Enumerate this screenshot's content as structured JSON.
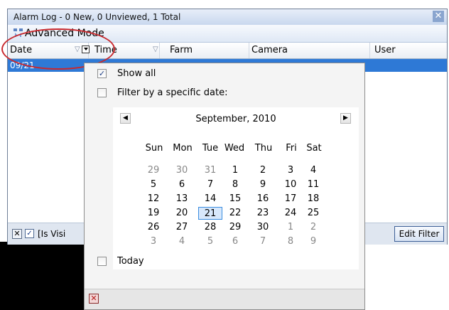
{
  "window": {
    "title": "Alarm Log - 0 New, 0 Unviewed, 1 Total",
    "close_glyph": "✕"
  },
  "toolbar": {
    "mode_label": "Advanced Mode",
    "mode_icon": "advanced-mode-icon"
  },
  "columns": [
    {
      "label": "Date"
    },
    {
      "label": "Time"
    },
    {
      "label": "Farm"
    },
    {
      "label": "Camera"
    },
    {
      "label": "User"
    }
  ],
  "selected_row": {
    "date": "09/21"
  },
  "filter_bar": {
    "clear_glyph": "✕",
    "visible_checked_glyph": "✓",
    "label": "[Is Visi",
    "edit_filter_label": "Edit Filter"
  },
  "popup": {
    "show_all": {
      "label": "Show all",
      "checked": true,
      "check_glyph": "✓"
    },
    "filter_date": {
      "label": "Filter by a specific date:",
      "checked": false
    },
    "today": {
      "label": "Today",
      "checked": false
    },
    "close_glyph": "✕"
  },
  "calendar": {
    "month_title": "September, 2010",
    "prev_glyph": "◀",
    "next_glyph": "▶",
    "weekdays": [
      "Sun",
      "Mon",
      "Tue",
      "Wed",
      "Thu",
      "Fri",
      "Sat"
    ],
    "selected_day": "21",
    "weeks": [
      [
        {
          "d": "29",
          "o": true
        },
        {
          "d": "30",
          "o": true
        },
        {
          "d": "31",
          "o": true
        },
        {
          "d": "1"
        },
        {
          "d": "2"
        },
        {
          "d": "3"
        },
        {
          "d": "4"
        }
      ],
      [
        {
          "d": "5"
        },
        {
          "d": "6"
        },
        {
          "d": "7"
        },
        {
          "d": "8"
        },
        {
          "d": "9"
        },
        {
          "d": "10"
        },
        {
          "d": "11"
        }
      ],
      [
        {
          "d": "12"
        },
        {
          "d": "13"
        },
        {
          "d": "14"
        },
        {
          "d": "15"
        },
        {
          "d": "16"
        },
        {
          "d": "17"
        },
        {
          "d": "18"
        }
      ],
      [
        {
          "d": "19"
        },
        {
          "d": "20"
        },
        {
          "d": "21"
        },
        {
          "d": "22"
        },
        {
          "d": "23"
        },
        {
          "d": "24"
        },
        {
          "d": "25"
        }
      ],
      [
        {
          "d": "26"
        },
        {
          "d": "27"
        },
        {
          "d": "28"
        },
        {
          "d": "29"
        },
        {
          "d": "30"
        },
        {
          "d": "1",
          "o": true
        },
        {
          "d": "2",
          "o": true
        }
      ],
      [
        {
          "d": "3",
          "o": true
        },
        {
          "d": "4",
          "o": true
        },
        {
          "d": "5",
          "o": true
        },
        {
          "d": "6",
          "o": true
        },
        {
          "d": "7",
          "o": true
        },
        {
          "d": "8",
          "o": true
        },
        {
          "d": "9",
          "o": true
        }
      ]
    ]
  },
  "colors": {
    "selection": "#2e79d6",
    "annotation": "#c8282d",
    "day_highlight": "#d8e8fb"
  }
}
